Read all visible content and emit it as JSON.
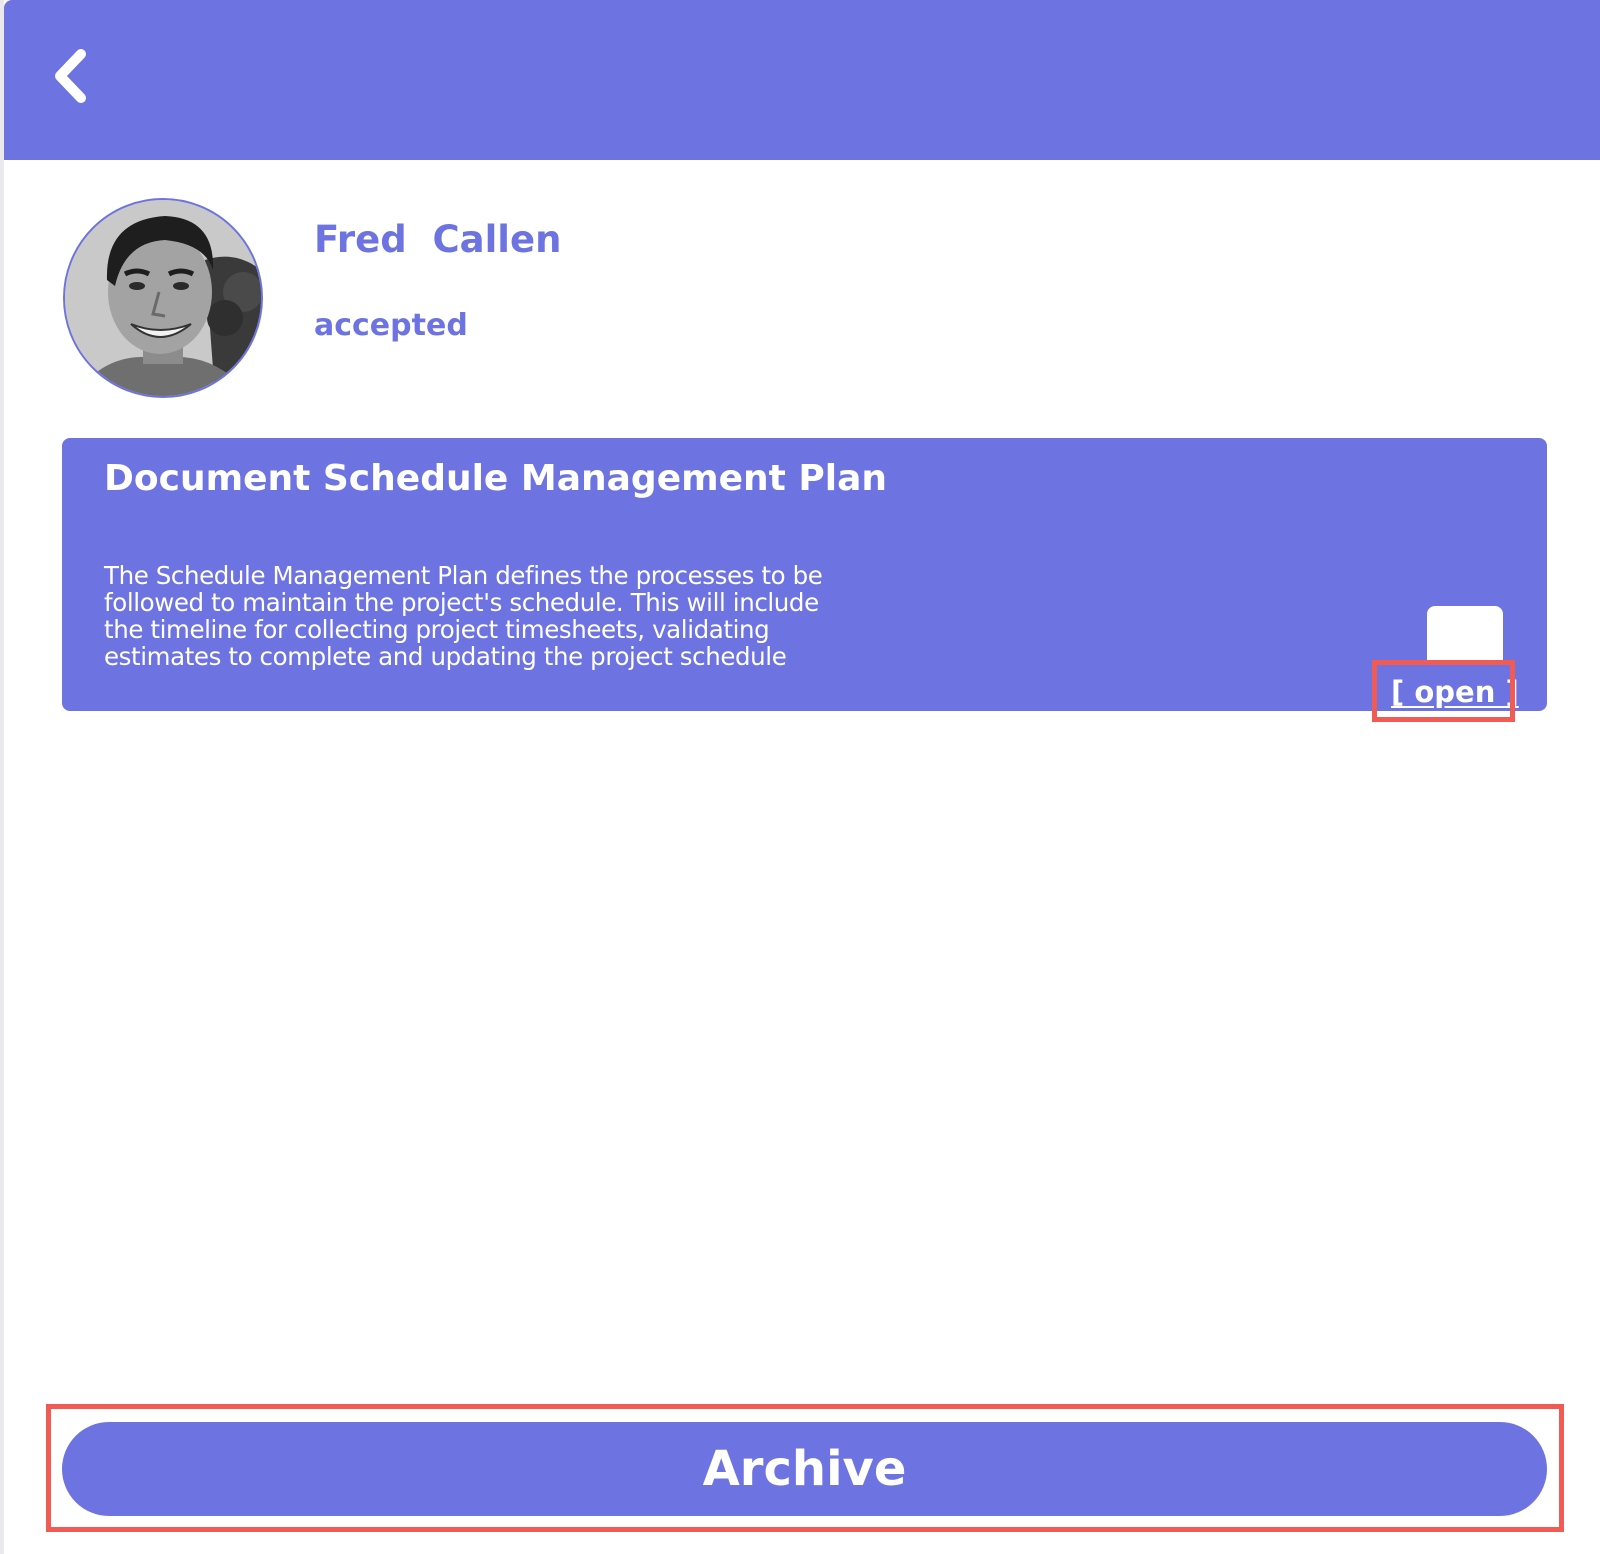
{
  "header": {
    "back_icon": "chevron-left-icon",
    "background_color": "#6d73e0"
  },
  "user": {
    "avatar_icon": "user-avatar-photo",
    "name": "Fred  Callen",
    "status": "accepted"
  },
  "task": {
    "title": "Document Schedule Management Plan",
    "description": "The Schedule Management Plan defines the processes to be followed to maintain the project's schedule.  This will include the timeline for collecting project timesheets, validating estimates to complete and updating the project schedule",
    "open_link": "[ open ]"
  },
  "actions": {
    "archive_label": "Archive"
  },
  "colors": {
    "accent": "#6d73e0",
    "highlight": "#f25a54",
    "text_on_accent": "#ffffff"
  }
}
